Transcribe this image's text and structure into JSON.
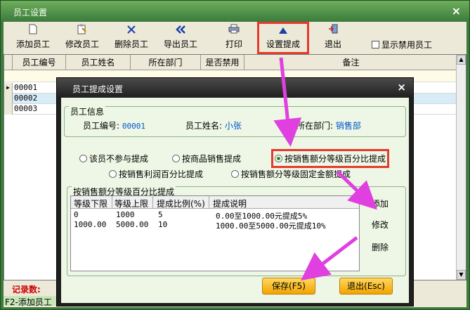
{
  "main": {
    "title": "员工设置",
    "close_glyph": "×",
    "toolbar": {
      "buttons": [
        {
          "label": "添加员工",
          "icon": "add-page-icon",
          "glyph": "▯"
        },
        {
          "label": "修改员工",
          "icon": "edit-clipboard-icon",
          "glyph": "▤"
        },
        {
          "label": "删除员工",
          "icon": "delete-x-icon",
          "glyph": "✕"
        },
        {
          "label": "导出员工",
          "icon": "export-double-arrow-icon",
          "glyph": "《"
        },
        {
          "label": "打印",
          "icon": "printer-icon",
          "glyph": "▦"
        },
        {
          "label": "设置提成",
          "icon": "up-arrow-icon",
          "glyph": "▲"
        },
        {
          "label": "退出",
          "icon": "exit-door-icon",
          "glyph": "⇥"
        }
      ],
      "show_disabled_label": "显示禁用员工"
    },
    "grid": {
      "columns": [
        "员工编号",
        "员工姓名",
        "所在部门",
        "是否禁用",
        "备注"
      ],
      "rows": [
        {
          "code": "00001",
          "selected": true
        },
        {
          "code": "00002",
          "selected": false
        },
        {
          "code": "00003",
          "selected": false
        }
      ]
    },
    "status": {
      "record_label": "记录数:",
      "hint": "F2-添加员工"
    }
  },
  "dialog": {
    "title": "员工提成设置",
    "close_glyph": "×",
    "employee_info": {
      "group_title": "员工信息",
      "id_label": "员工编号:",
      "id_value": "00001",
      "name_label": "员工姓名:",
      "name_value": "小张",
      "dept_label": "所在部门:",
      "dept_value": "销售部"
    },
    "commission_options": [
      {
        "label": "该员不参与提成",
        "checked": false
      },
      {
        "label": "按商品销售提成",
        "checked": false
      },
      {
        "label": "按销售额分等级百分比提成",
        "checked": true
      },
      {
        "label": "按销售利润百分比提成",
        "checked": false
      },
      {
        "label": "按销售额分等级固定金额提成",
        "checked": false
      }
    ],
    "tier_group": {
      "title": "按销售额分等级百分比提成",
      "headers": [
        "等级下限",
        "等级上限",
        "提成比例(%)",
        "提成说明"
      ],
      "rows": [
        [
          "0",
          "1000",
          "5",
          "0.00至1000.00元提成5%"
        ],
        [
          "1000.00",
          "5000.00",
          "10",
          "1000.00至5000.00元提成10%"
        ]
      ]
    },
    "side_actions": {
      "add": "添加",
      "edit": "修改",
      "delete": "删除"
    },
    "buttons": {
      "save": "保存(F5)",
      "exit": "退出(Esc)"
    }
  },
  "colors": {
    "highlight_box": "#e53a2d",
    "annotation_arrow": "#e040e0",
    "selection_blue": "#d8ecf8",
    "accent_orange": "#f0a400"
  }
}
